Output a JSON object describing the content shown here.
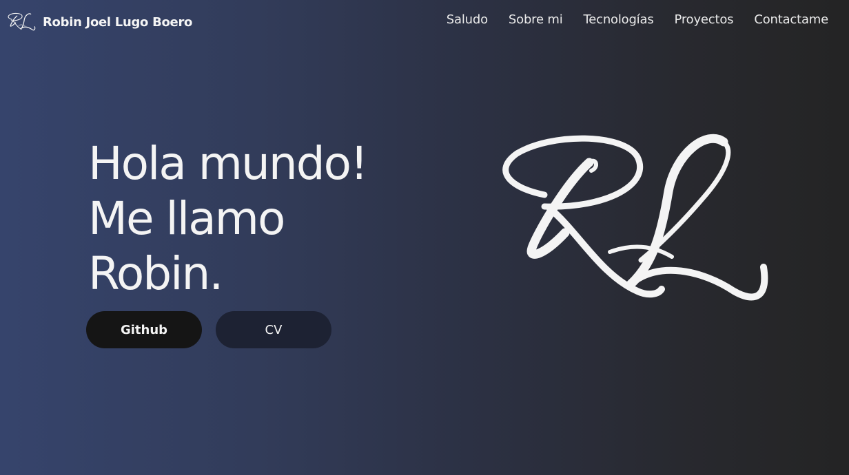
{
  "header": {
    "brand_name": "Robin Joel Lugo Boero",
    "logo_icon": "rl-monogram-icon"
  },
  "nav": {
    "items": [
      {
        "label": "Saludo"
      },
      {
        "label": "Sobre mi"
      },
      {
        "label": "Tecnologías"
      },
      {
        "label": "Proyectos"
      },
      {
        "label": "Contactame"
      }
    ]
  },
  "hero": {
    "lines": [
      "Hola mundo!",
      "Me llamo",
      "Robin."
    ],
    "buttons": {
      "github_label": "Github",
      "cv_label": "CV"
    },
    "logo_icon": "rl-monogram-icon"
  },
  "colors": {
    "gradient_left": "#36446c",
    "gradient_right": "#242424",
    "github_button": "#151515",
    "cv_button": "#1d2233",
    "text": "#f4f4f4"
  }
}
